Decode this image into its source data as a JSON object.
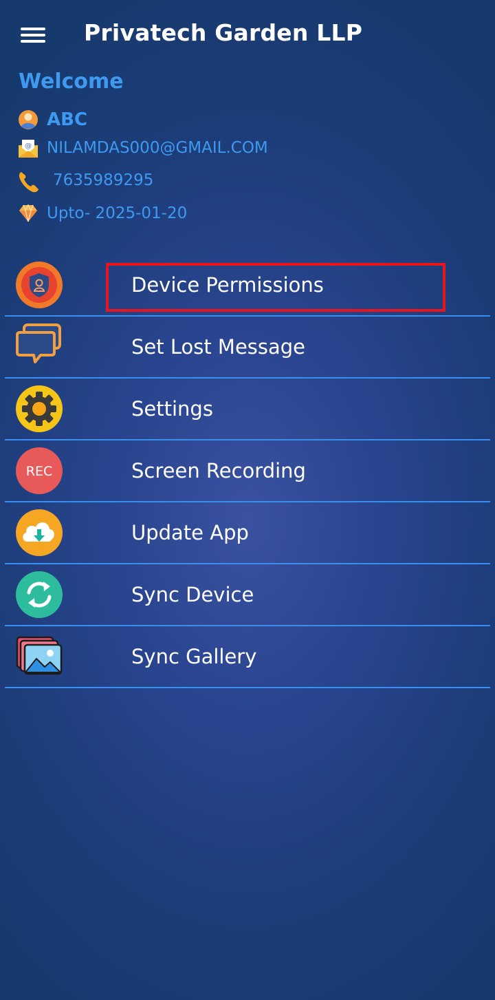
{
  "header": {
    "title": "Privatech Garden LLP",
    "menu_icon": "hamburger-menu-icon"
  },
  "profile": {
    "welcome": "Welcome",
    "name": "ABC",
    "email": "NILAMDAS000@GMAIL.COM",
    "phone": "7635989295",
    "validity": "Upto- 2025-01-20",
    "icons": [
      "user-avatar-icon",
      "email-icon",
      "phone-icon",
      "diamond-icon"
    ]
  },
  "menu": {
    "items": [
      {
        "label": "Device Permissions",
        "icon": "shield-user-icon"
      },
      {
        "label": "Set Lost Message",
        "icon": "chat-bubbles-icon"
      },
      {
        "label": "Settings",
        "icon": "gear-icon"
      },
      {
        "label": "Screen Recording",
        "icon": "rec-icon",
        "icon_text": "REC"
      },
      {
        "label": "Update App",
        "icon": "cloud-download-icon"
      },
      {
        "label": "Sync Device",
        "icon": "sync-icon"
      },
      {
        "label": "Sync Gallery",
        "icon": "gallery-icon"
      }
    ]
  },
  "colors": {
    "accent": "#3e9af0",
    "divider": "#3a8ef0",
    "highlight": "#e8141e",
    "background": "#1d3d7a"
  }
}
